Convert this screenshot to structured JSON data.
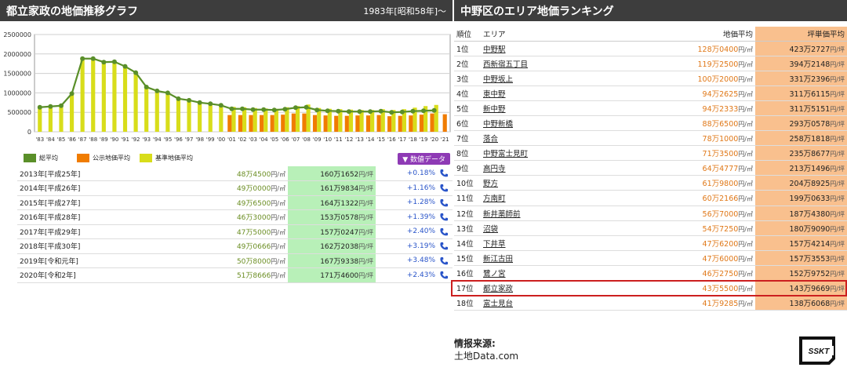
{
  "left": {
    "title": "都立家政の地価推移グラフ",
    "subtitle": "1983年[昭和58年]〜"
  },
  "chart_data": {
    "type": "bar+line",
    "title": "都立家政の地価推移グラフ",
    "x": [
      "'83",
      "'84",
      "'85",
      "'86",
      "'87",
      "'88",
      "'89",
      "'90",
      "'91",
      "'92",
      "'93",
      "'94",
      "'95",
      "'96",
      "'97",
      "'98",
      "'99",
      "'00",
      "'01",
      "'02",
      "'03",
      "'04",
      "'05",
      "'06",
      "'07",
      "'08",
      "'09",
      "'10",
      "'11",
      "'12",
      "'13",
      "'14",
      "'15",
      "'16",
      "'17",
      "'18",
      "'19",
      "'20",
      "'21"
    ],
    "ylim": [
      0,
      2500000
    ],
    "yticks": [
      "0",
      "500000",
      "1000000",
      "1500000",
      "2000000",
      "2500000"
    ],
    "series": [
      {
        "name": "総平均",
        "kind": "line",
        "color": "#5a8f29",
        "values": [
          630000,
          650000,
          670000,
          980000,
          1880000,
          1880000,
          1790000,
          1800000,
          1680000,
          1520000,
          1150000,
          1050000,
          1000000,
          850000,
          810000,
          750000,
          720000,
          680000,
          590000,
          590000,
          570000,
          570000,
          560000,
          580000,
          620000,
          630000,
          560000,
          540000,
          530000,
          520000,
          520000,
          520000,
          530000,
          500000,
          510000,
          530000,
          540000,
          550000,
          null
        ]
      },
      {
        "name": "公示地価平均",
        "kind": "bar",
        "color": "#f07c00",
        "values": [
          null,
          null,
          null,
          null,
          null,
          null,
          null,
          null,
          null,
          null,
          null,
          null,
          null,
          null,
          null,
          null,
          null,
          null,
          430000,
          430000,
          430000,
          430000,
          430000,
          440000,
          470000,
          470000,
          430000,
          420000,
          410000,
          410000,
          420000,
          420000,
          430000,
          400000,
          410000,
          420000,
          440000,
          470000,
          450000
        ]
      },
      {
        "name": "基準地価平均",
        "kind": "bar",
        "color": "#d8dd1a",
        "values": [
          640000,
          660000,
          680000,
          1010000,
          1900000,
          1900000,
          1810000,
          1790000,
          1690000,
          1510000,
          1160000,
          1060000,
          1010000,
          860000,
          820000,
          760000,
          730000,
          690000,
          640000,
          630000,
          610000,
          600000,
          590000,
          630000,
          660000,
          700000,
          610000,
          590000,
          580000,
          570000,
          560000,
          560000,
          580000,
          560000,
          580000,
          620000,
          660000,
          690000,
          null
        ]
      }
    ],
    "legend_position": "bottom-left",
    "grid": true
  },
  "legend": {
    "items": [
      "総平均",
      "公示地価平均",
      "基準地価平均"
    ],
    "data_tab": "▼ 数値データ"
  },
  "year_table": {
    "unit_m2": "円/㎡",
    "unit_tsubo": "円/坪",
    "rows": [
      {
        "year": "2013年[平成25年]",
        "price": "48万4500",
        "tsubo": "160万1652",
        "change": "+0.18"
      },
      {
        "year": "2014年[平成26年]",
        "price": "49万0000",
        "tsubo": "161万9834",
        "change": "+1.16"
      },
      {
        "year": "2015年[平成27年]",
        "price": "49万6500",
        "tsubo": "164万1322",
        "change": "+1.28"
      },
      {
        "year": "2016年[平成28年]",
        "price": "46万3000",
        "tsubo": "153万0578",
        "change": "+1.39"
      },
      {
        "year": "2017年[平成29年]",
        "price": "47万5000",
        "tsubo": "157万0247",
        "change": "+2.40"
      },
      {
        "year": "2018年[平成30年]",
        "price": "49万0666",
        "tsubo": "162万2038",
        "change": "+3.19"
      },
      {
        "year": "2019年[令和元年]",
        "price": "50万8000",
        "tsubo": "167万9338",
        "change": "+3.48"
      },
      {
        "year": "2020年[令和2年]",
        "price": "51万8666",
        "tsubo": "171万4600",
        "change": "+2.43"
      }
    ],
    "percent": "%"
  },
  "right": {
    "title": "中野区のエリア地価ランキング",
    "headers": {
      "rank": "順位",
      "area": "エリア",
      "price": "地価平均",
      "tsubo": "坪単価平均"
    },
    "unit_m2": "円/㎡",
    "unit_tsubo": "円/坪",
    "highlight_rank": "17位",
    "rows": [
      {
        "rank": "1位",
        "area": "中野駅",
        "price": "128万0400",
        "tsubo": "423万2727"
      },
      {
        "rank": "2位",
        "area": "西新宿五丁目",
        "price": "119万2500",
        "tsubo": "394万2148"
      },
      {
        "rank": "3位",
        "area": "中野坂上",
        "price": "100万2000",
        "tsubo": "331万2396"
      },
      {
        "rank": "4位",
        "area": "東中野",
        "price": "94万2625",
        "tsubo": "311万6115"
      },
      {
        "rank": "5位",
        "area": "新中野",
        "price": "94万2333",
        "tsubo": "311万5151"
      },
      {
        "rank": "6位",
        "area": "中野新橋",
        "price": "88万6500",
        "tsubo": "293万0578"
      },
      {
        "rank": "7位",
        "area": "落合",
        "price": "78万1000",
        "tsubo": "258万1818"
      },
      {
        "rank": "8位",
        "area": "中野富士見町",
        "price": "71万3500",
        "tsubo": "235万8677"
      },
      {
        "rank": "9位",
        "area": "高円寺",
        "price": "64万4777",
        "tsubo": "213万1496"
      },
      {
        "rank": "10位",
        "area": "野方",
        "price": "61万9800",
        "tsubo": "204万8925"
      },
      {
        "rank": "11位",
        "area": "方南町",
        "price": "60万2166",
        "tsubo": "199万0633"
      },
      {
        "rank": "12位",
        "area": "新井薬師前",
        "price": "56万7000",
        "tsubo": "187万4380"
      },
      {
        "rank": "13位",
        "area": "沼袋",
        "price": "54万7250",
        "tsubo": "180万9090"
      },
      {
        "rank": "14位",
        "area": "下井草",
        "price": "47万6200",
        "tsubo": "157万4214"
      },
      {
        "rank": "15位",
        "area": "新江古田",
        "price": "47万6000",
        "tsubo": "157万3553"
      },
      {
        "rank": "16位",
        "area": "鷺ノ宮",
        "price": "46万2750",
        "tsubo": "152万9752"
      },
      {
        "rank": "17位",
        "area": "都立家政",
        "price": "43万5500",
        "tsubo": "143万9669"
      },
      {
        "rank": "18位",
        "area": "富士見台",
        "price": "41万9285",
        "tsubo": "138万6068"
      }
    ]
  },
  "source": {
    "label": "情报来源:",
    "value": "土地Data.com"
  },
  "logo": {
    "text": "SSKT"
  }
}
